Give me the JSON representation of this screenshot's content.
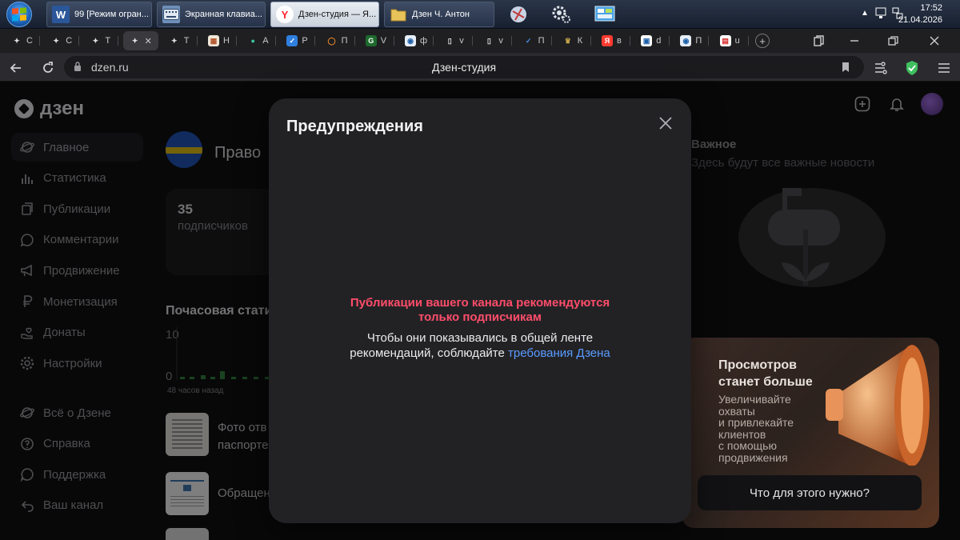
{
  "taskbar": {
    "buttons": [
      {
        "label": "99 [Режим огран...",
        "icon": "word-icon"
      },
      {
        "label": "Экранная клавиа...",
        "icon": "keyboard-icon"
      },
      {
        "label": "Дзен-студия — Я...",
        "icon": "yandex-browser-icon"
      },
      {
        "label": "Дзен Ч. Антон",
        "icon": "folder-icon"
      }
    ],
    "pinned": [
      "satellite-icon",
      "gears-icon",
      "control-panel-icon"
    ],
    "clock": {
      "time": "17:52",
      "date": "21.04.2026"
    }
  },
  "tabs": [
    {
      "letter": "С",
      "icon": "sparkle-icon"
    },
    {
      "letter": "С",
      "icon": "sparkle-icon"
    },
    {
      "letter": "Т",
      "icon": "sparkle-icon"
    },
    {
      "letter": "✕",
      "icon": "sparkle-icon",
      "active": true
    },
    {
      "letter": "Т",
      "icon": "sparkle-icon"
    },
    {
      "letter": "Н",
      "icon": "grid-icon"
    },
    {
      "letter": "А",
      "icon": "colorful-icon"
    },
    {
      "letter": "Р",
      "icon": "shield-icon"
    },
    {
      "letter": "П",
      "icon": "search-icon"
    },
    {
      "letter": "V",
      "icon": "gs1-icon"
    },
    {
      "letter": "ф",
      "icon": "globe-icon"
    },
    {
      "letter": "v",
      "icon": "doc-icon"
    },
    {
      "letter": "v",
      "icon": "doc-icon"
    },
    {
      "letter": "П",
      "icon": "check-icon"
    },
    {
      "letter": "К",
      "icon": "crest-icon"
    },
    {
      "letter": "в",
      "icon": "yandex-icon"
    },
    {
      "letter": "d",
      "icon": "monitor-icon"
    },
    {
      "letter": "П",
      "icon": "globe-icon"
    },
    {
      "letter": "u",
      "icon": "pdf-icon"
    }
  ],
  "address": {
    "url": "dzen.ru",
    "title": "Дзен-студия"
  },
  "brand": {
    "name": "дзен"
  },
  "sidebar": {
    "items": [
      {
        "label": "Главное",
        "icon": "planet-icon"
      },
      {
        "label": "Статистика",
        "icon": "bar-chart-icon"
      },
      {
        "label": "Публикации",
        "icon": "publications-icon"
      },
      {
        "label": "Комментарии",
        "icon": "comment-icon"
      },
      {
        "label": "Продвижение",
        "icon": "megaphone-icon"
      },
      {
        "label": "Монетизация",
        "icon": "ruble-icon"
      },
      {
        "label": "Донаты",
        "icon": "donate-icon"
      },
      {
        "label": "Настройки",
        "icon": "gear-icon"
      }
    ],
    "bottom": [
      {
        "label": "Всё о Дзене",
        "icon": "planet-icon"
      },
      {
        "label": "Справка",
        "icon": "help-icon"
      },
      {
        "label": "Поддержка",
        "icon": "support-icon"
      },
      {
        "label": "Ваш канал",
        "icon": "channel-icon"
      }
    ]
  },
  "channel": {
    "name": "Право",
    "subscribers": "35",
    "subscribers_label": "подписчиков"
  },
  "hourly": {
    "title": "Почасовая статис",
    "y_max": "10",
    "y_min": "0",
    "caption": "48 часов назад"
  },
  "pubs": [
    {
      "title": "Фото отв",
      "title2": "паспорте"
    },
    {
      "title": "Обращен"
    }
  ],
  "important": {
    "title": "Важное",
    "subtitle": "Здесь будут все важные новости"
  },
  "modal": {
    "title": "Предупреждения",
    "warning_line1": "Публикации вашего канала рекомендуются",
    "warning_line2": "только подписчикам",
    "text_line1": "Чтобы они показывались в общей ленте",
    "text_line2": "рекомендаций, соблюдайте ",
    "link": "требования Дзена"
  },
  "promo": {
    "title_line1": "Просмотров",
    "title_line2": "станет больше",
    "text": [
      "Увеличивайте",
      "охваты",
      "и привлекайте",
      "клиентов",
      "с помощью",
      "продвижения"
    ],
    "button": "Что для этого нужно?"
  },
  "colors": {
    "accent_link": "#5a9bff",
    "warning": "#ff4d6a",
    "shield_green": "#3fbf5f"
  }
}
